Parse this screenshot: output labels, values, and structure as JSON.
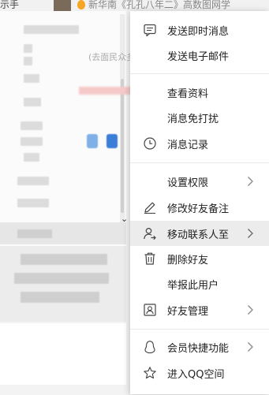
{
  "background": {
    "title_fragment_left": "示手",
    "title_fragment_right": "新华南《孔孔八年二》高数图网学",
    "inner_fragment": "(去面民众多人的热点我们信"
  },
  "menu": {
    "items": [
      {
        "label": "发送即时消息",
        "icon": "chat-bubble-icon"
      },
      {
        "label": "发送电子邮件",
        "icon": ""
      },
      {
        "label": "查看资料",
        "icon": ""
      },
      {
        "label": "消息免打扰",
        "icon": ""
      },
      {
        "label": "消息记录",
        "icon": "clock-icon"
      },
      {
        "label": "设置权限",
        "icon": "",
        "submenu": true
      },
      {
        "label": "修改好友备注",
        "icon": "pencil-icon"
      },
      {
        "label": "移动联系人至",
        "icon": "move-contact-icon",
        "submenu": true,
        "hovered": true
      },
      {
        "label": "删除好友",
        "icon": "trash-icon"
      },
      {
        "label": "举报此用户",
        "icon": ""
      },
      {
        "label": "好友管理",
        "icon": "contact-card-icon",
        "submenu": true
      },
      {
        "label": "会员快捷功能",
        "icon": "penguin-icon",
        "submenu": true
      },
      {
        "label": "进入QQ空间",
        "icon": "star-icon"
      }
    ]
  },
  "colors": {
    "menu_bg": "#ffffff",
    "hover_bg": "#ececec",
    "text": "#222222"
  }
}
